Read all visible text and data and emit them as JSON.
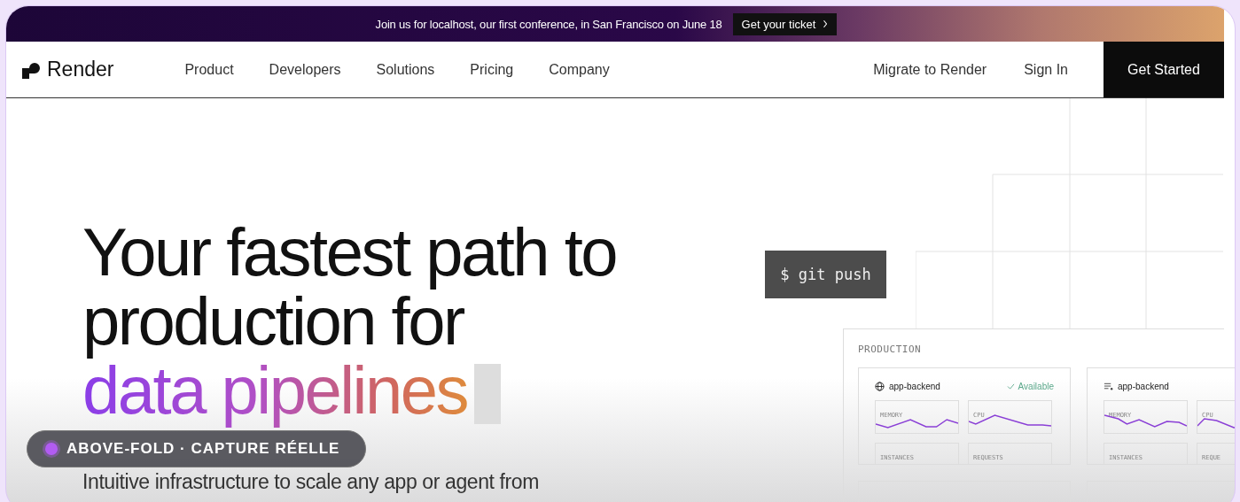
{
  "banner": {
    "text": "Join us for localhost, our first conference, in San Francisco on June 18",
    "button": "Get your ticket"
  },
  "nav": {
    "logo": "Render",
    "links": [
      "Product",
      "Developers",
      "Solutions",
      "Pricing",
      "Company"
    ],
    "migrate": "Migrate to Render",
    "sign_in": "Sign In",
    "cta": "Get Started"
  },
  "hero": {
    "heading_lines": [
      "Your fastest path to",
      "production for"
    ],
    "highlight": "data pipelines",
    "subtitle": "Intuitive infrastructure to scale any app or agent from"
  },
  "terminal": {
    "command": "$ git push"
  },
  "production": {
    "title": "PRODUCTION",
    "services": [
      {
        "name": "app-backend",
        "kind": "web",
        "status": "Available",
        "metrics": [
          "MEMORY",
          "CPU",
          "INSTANCES",
          "REQUESTS"
        ]
      },
      {
        "name": "app-backend",
        "kind": "worker",
        "metrics": [
          "MEMORY",
          "CPU",
          "INSTANCES",
          "REQUE"
        ]
      }
    ]
  },
  "badge": {
    "text": "ABOVE-FOLD · CAPTURE RÉELLE"
  }
}
